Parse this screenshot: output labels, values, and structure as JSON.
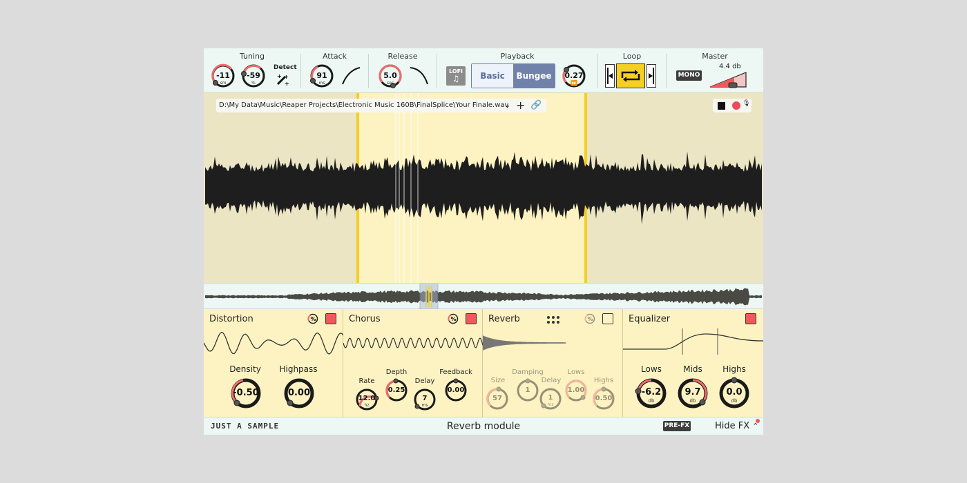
{
  "header": {
    "tuning": {
      "title": "Tuning",
      "semitones": "-11",
      "semitones_unit": "sm",
      "cents": "-59",
      "cents_unit": "%",
      "detect_label": "Detect"
    },
    "attack": {
      "title": "Attack",
      "value": "91",
      "unit": "ms"
    },
    "release": {
      "title": "Release",
      "value": "5.0",
      "unit": "sec"
    },
    "playback": {
      "title": "Playback",
      "lofi_label": "LOFI",
      "basic_label": "Basic",
      "bungee_label": "Bungee",
      "speed": "0.27",
      "selected_mode": "Bungee"
    },
    "loop": {
      "title": "Loop"
    },
    "master": {
      "title": "Master",
      "mono_label": "MONO",
      "gain": "4.4 db"
    }
  },
  "file": {
    "path": "D:\\My Data\\Music\\Reaper Projects\\Electronic Music 160B\\FinalSplice\\Your Finale.wav"
  },
  "fx": {
    "distortion": {
      "title": "Distortion",
      "enabled": true,
      "density": {
        "label": "Density",
        "value": "-0.50"
      },
      "highpass": {
        "label": "Highpass",
        "value": "0.00"
      }
    },
    "chorus": {
      "title": "Chorus",
      "enabled": true,
      "rate": {
        "label": "Rate",
        "value": "12.0",
        "unit": "hz"
      },
      "depth": {
        "label": "Depth",
        "value": "0.25"
      },
      "delay": {
        "label": "Delay",
        "value": "7",
        "unit": "ms"
      },
      "feedback": {
        "label": "Feedback",
        "value": "0.00"
      }
    },
    "reverb": {
      "title": "Reverb",
      "enabled": false,
      "size": {
        "label": "Size",
        "value": "57"
      },
      "damping": {
        "label": "Damping",
        "value": "1"
      },
      "delay": {
        "label": "Delay",
        "value": "1",
        "unit": "ms"
      },
      "lows": {
        "label": "Lows",
        "value": "1.00"
      },
      "highs": {
        "label": "Highs",
        "value": "0.50"
      }
    },
    "equalizer": {
      "title": "Equalizer",
      "enabled": true,
      "lows": {
        "label": "Lows",
        "value": "-6.2",
        "unit": "db"
      },
      "mids": {
        "label": "Mids",
        "value": "9.7",
        "unit": "db"
      },
      "highs": {
        "label": "Highs",
        "value": "0.0",
        "unit": "db"
      }
    }
  },
  "footer": {
    "brand": "JUST A SAMPLE",
    "status": "Reverb module",
    "prefx_label": "PRE-FX",
    "hidefx_label": "Hide FX"
  }
}
